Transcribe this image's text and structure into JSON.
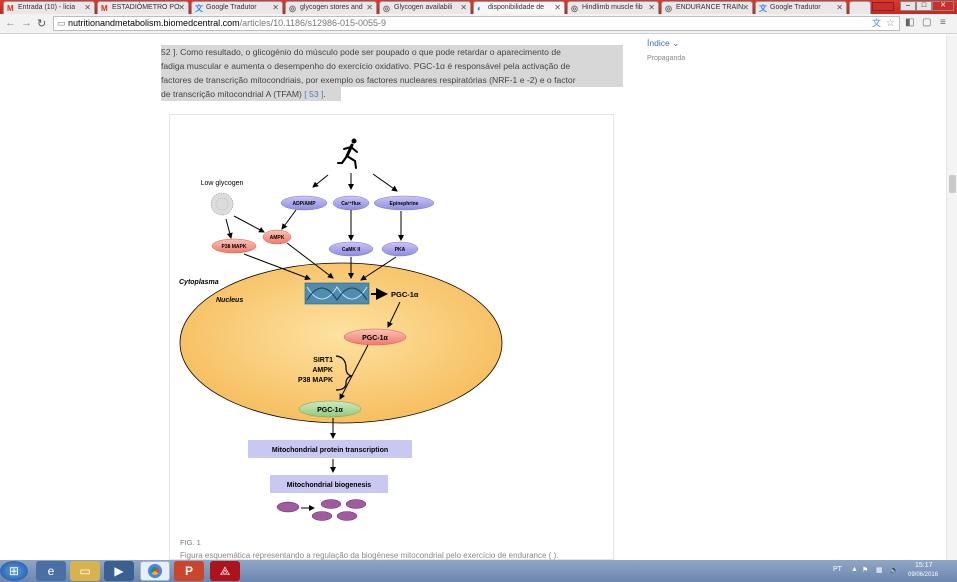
{
  "browser": {
    "tabs": [
      {
        "label": "Entrada (10) - licia",
        "fav": "M",
        "fav_color": "#d93025"
      },
      {
        "label": "ESTADIÔMETRO PO",
        "fav": "M",
        "fav_color": "#d93025"
      },
      {
        "label": "Google Tradutor",
        "fav": "文",
        "fav_color": "#4285f4"
      },
      {
        "label": "glycogen stores and",
        "fav": "◎",
        "fav_color": "#666"
      },
      {
        "label": "Glycogen availabili",
        "fav": "◎",
        "fav_color": "#666"
      },
      {
        "label": "disponibilidade de",
        "fav": "◐",
        "fav_color": "#1a73e8"
      },
      {
        "label": "Hindlimb muscle fib",
        "fav": "◎",
        "fav_color": "#666"
      },
      {
        "label": "ENDURANCE TRAIN",
        "fav": "◎",
        "fav_color": "#666"
      },
      {
        "label": "Google Tradutor",
        "fav": "文",
        "fav_color": "#4285f4"
      }
    ],
    "url_domain": "nutritionandmetabolism.biomedcentral.com",
    "url_path": "/articles/10.1186/s12986-015-0055-9"
  },
  "article": {
    "lines": [
      "52 ]. Como resultado, o glicogénio do músculo pode ser poupado o que pode retardar o aparecimento de",
      "fadiga muscular e aumenta o desempenho do exercício oxidativo. PGC-1α é responsável pela activação de",
      "factores de transcrição mitocondriais, por exemplo os factores nucleares respiratórias (NRF-1 e -2) e o factor"
    ],
    "last_line": "de transcrição mitocondrial A (TFAM)",
    "last_ref": "[ 53 ]",
    "last_end": ".",
    "sidebar_index": "Índice",
    "sidebar_ad": "Propaganda"
  },
  "figure": {
    "low_glycogen": "Low glycogen",
    "adp_amp": "ADP/AMP",
    "ca_flux": "Ca²⁺flux",
    "epinephrine": "Epinephrine",
    "ampk": "AMPK",
    "p38": "P38 MAPK",
    "camk": "CaMK II",
    "pka": "PKA",
    "cytoplasma": "Cytoplasma",
    "nucleus": "Nucleus",
    "pgc_top": "PGC-1α",
    "pgc_mid": "PGC-1α",
    "sirt1": "SIRT1",
    "ampk2": "AMPK",
    "p38_2": "P38 MAPK",
    "pgc_bottom": "PGC-1α",
    "transcription": "Mitochondrial protein transcription",
    "biogenesis": "Mitochondrial biogenesis",
    "fig_label": "FIG. 1",
    "caption": "Figura esquemática representando a regulação da biogénese mitocondrial pelo exercício de endurance (  )."
  },
  "taskbar": {
    "lang": "PT",
    "time": "15:17",
    "date": "09/06/2016"
  }
}
